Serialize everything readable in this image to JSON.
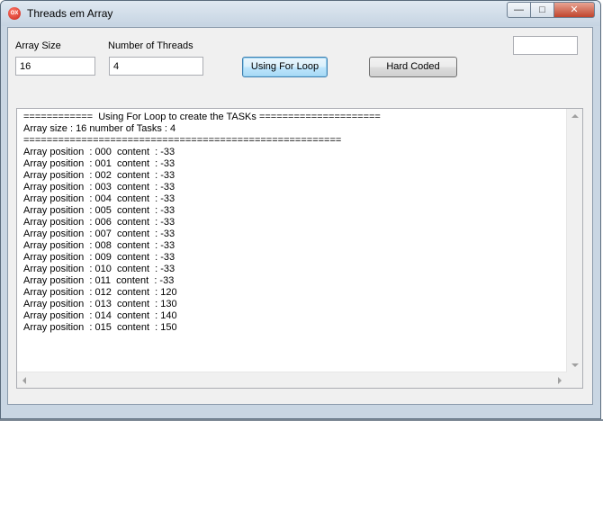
{
  "window": {
    "title": "Threads em Array",
    "app_icon_text": "OX",
    "minimize_glyph": "—",
    "maximize_glyph": "□",
    "close_glyph": "✕"
  },
  "form": {
    "array_size_label": "Array Size",
    "array_size_value": "16",
    "threads_label": "Number of  Threads",
    "threads_value": "4",
    "for_loop_button": "Using For Loop",
    "hard_coded_button": "Hard Coded",
    "extra_field_value": ""
  },
  "output": {
    "lines": [
      "============  Using For Loop to create the TASKs =====================",
      "Array size : 16 number of Tasks : 4",
      "=======================================================",
      "Array position  : 000  content  : -33",
      "Array position  : 001  content  : -33",
      "Array position  : 002  content  : -33",
      "Array position  : 003  content  : -33",
      "Array position  : 004  content  : -33",
      "Array position  : 005  content  : -33",
      "Array position  : 006  content  : -33",
      "Array position  : 007  content  : -33",
      "Array position  : 008  content  : -33",
      "Array position  : 009  content  : -33",
      "Array position  : 010  content  : -33",
      "Array position  : 011  content  : -33",
      "Array position  : 012  content  : 120",
      "Array position  : 013  content  : 130",
      "Array position  : 014  content  : 140",
      "Array position  : 015  content  : 150"
    ]
  }
}
